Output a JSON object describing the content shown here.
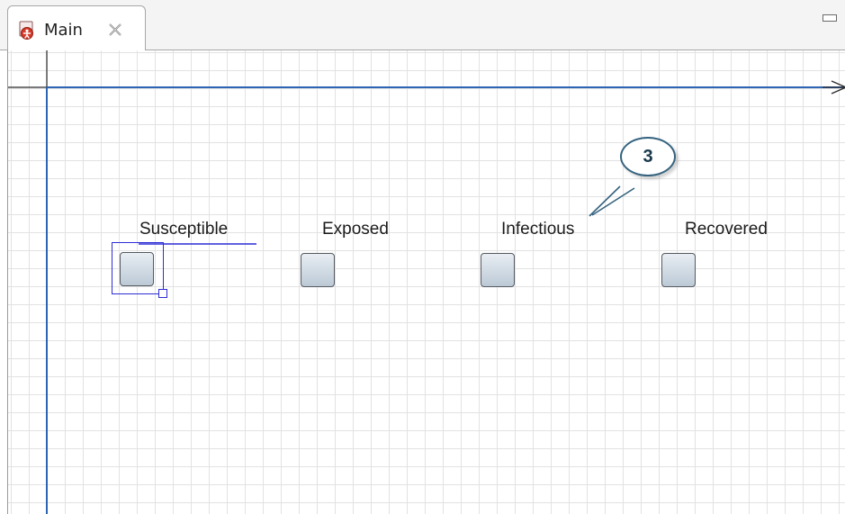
{
  "tab": {
    "label": "Main",
    "icon": "agent-icon",
    "close_icon": "close-icon"
  },
  "window": {
    "minimize_icon": "minimize-icon"
  },
  "canvas": {
    "axis_arrow_icon": "arrow-right-icon",
    "states": [
      {
        "label": "Susceptible",
        "selected": true
      },
      {
        "label": "Exposed",
        "selected": false
      },
      {
        "label": "Infectious",
        "selected": false
      },
      {
        "label": "Recovered",
        "selected": false
      }
    ],
    "callout": {
      "number": "3",
      "points_to": "Infectious"
    }
  },
  "colors": {
    "axis_blue": "#2d64b4",
    "selection_blue": "#2d2dd6",
    "grid": "#e2e2e2",
    "callout_border": "#35637f"
  }
}
